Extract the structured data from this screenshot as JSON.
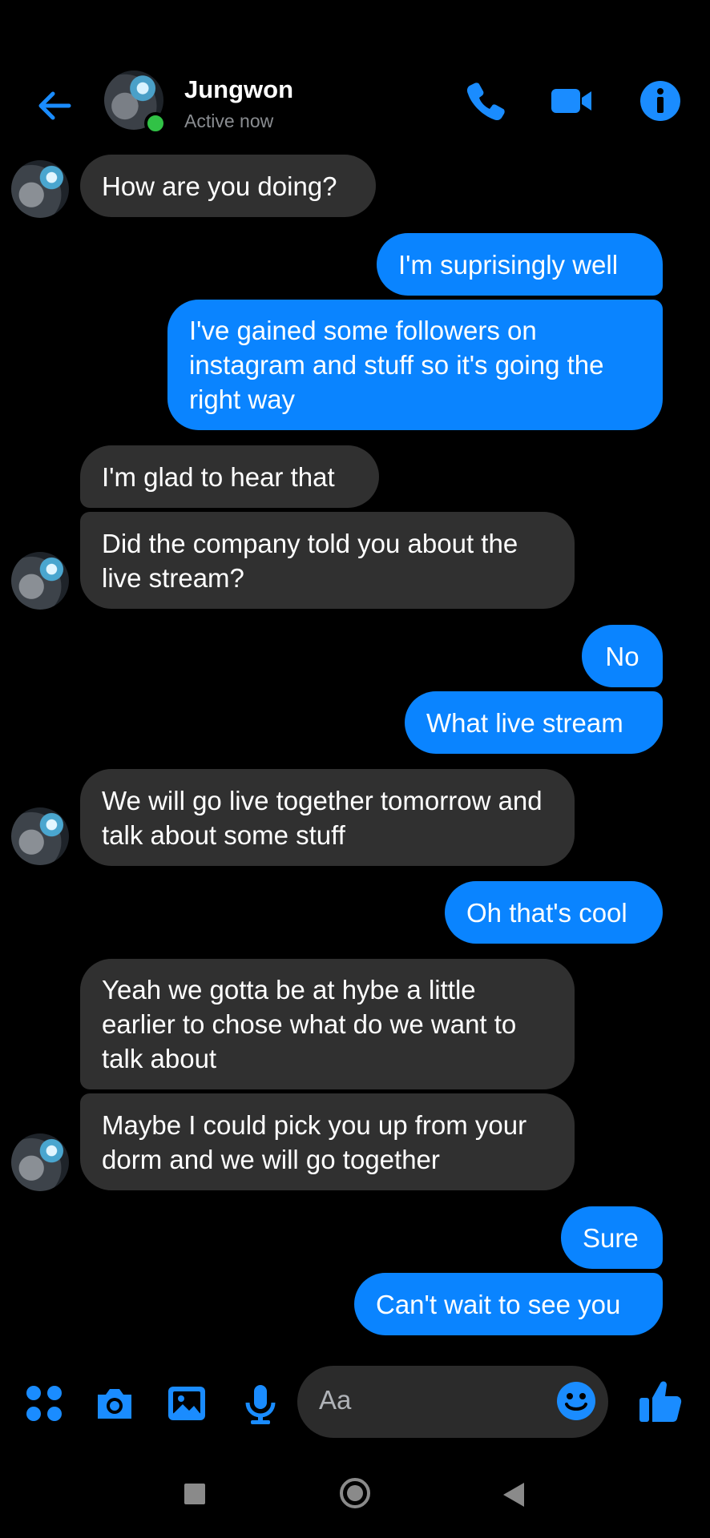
{
  "header": {
    "contact_name": "Jungwon",
    "status": "Active now",
    "icons": [
      "back-arrow-icon",
      "phone-icon",
      "video-camera-icon",
      "info-icon"
    ]
  },
  "colors": {
    "accent": "#0a84ff",
    "incoming_bubble": "#303030",
    "background": "#000000",
    "online": "#31c246"
  },
  "messages": [
    {
      "from": "them",
      "text": "How are you doing?"
    },
    {
      "from": "me",
      "text": "I'm suprisingly well"
    },
    {
      "from": "me",
      "text": "I've gained some followers on instagram and stuff so it's going the right way"
    },
    {
      "from": "them",
      "text": "I'm glad to hear that"
    },
    {
      "from": "them",
      "text": "Did the company told you about the live stream?"
    },
    {
      "from": "me",
      "text": "No"
    },
    {
      "from": "me",
      "text": "What live stream"
    },
    {
      "from": "them",
      "text": "We will go live together tomorrow and talk about some stuff"
    },
    {
      "from": "me",
      "text": "Oh that's cool"
    },
    {
      "from": "them",
      "text": "Yeah we gotta be at hybe a little earlier to chose what do we want to talk about"
    },
    {
      "from": "them",
      "text": "Maybe I could pick you up from your dorm and we will go together"
    },
    {
      "from": "me",
      "text": "Sure"
    },
    {
      "from": "me",
      "text": "Can't wait to see you"
    }
  ],
  "composer": {
    "placeholder": "Aa",
    "icons": [
      "menu-dots-icon",
      "camera-icon",
      "image-icon",
      "microphone-icon",
      "emoji-icon",
      "thumbs-up-icon"
    ]
  },
  "navbar": {
    "icons": [
      "recents-square-icon",
      "home-circle-icon",
      "back-triangle-icon"
    ]
  }
}
